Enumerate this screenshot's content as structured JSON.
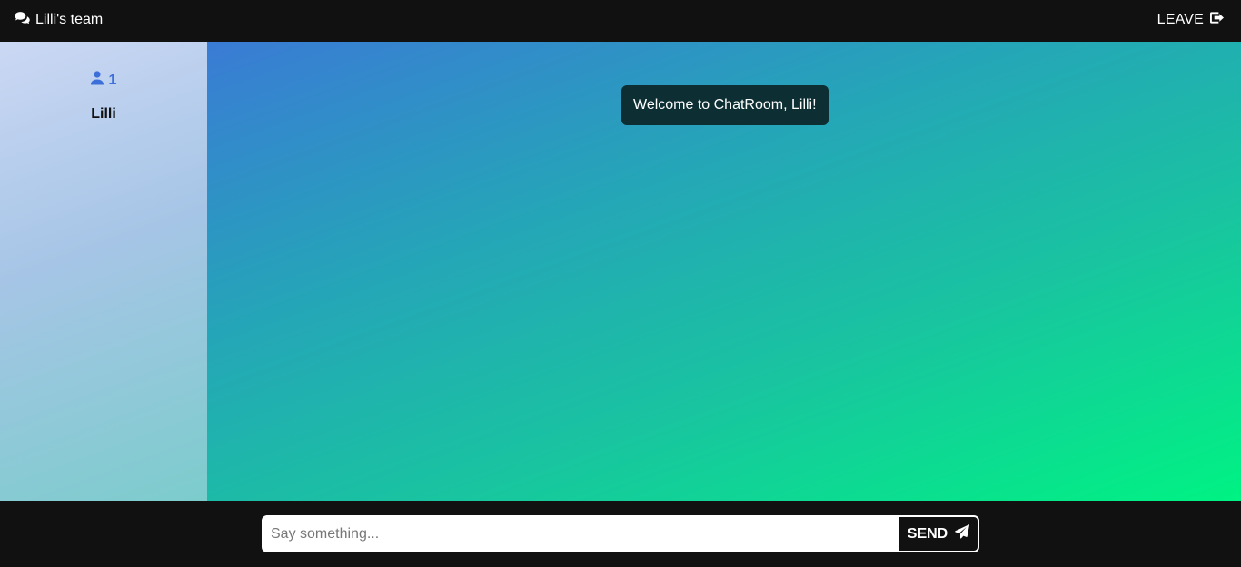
{
  "header": {
    "team_name": "Lilli's team",
    "team_icon": "comments-icon",
    "leave_label": "LEAVE",
    "leave_icon": "sign-out-icon"
  },
  "sidebar": {
    "user_icon": "user-icon",
    "user_count": "1",
    "users": [
      "Lilli"
    ]
  },
  "chat": {
    "messages": [
      {
        "text": "Welcome to ChatRoom, Lilli!"
      }
    ]
  },
  "composer": {
    "placeholder": "Say something...",
    "value": "",
    "send_label": "SEND",
    "send_icon": "paper-plane-icon"
  },
  "colors": {
    "bar_background": "#111111",
    "accent_user": "#3d6fd8",
    "bubble_background": "#0d2f33"
  }
}
